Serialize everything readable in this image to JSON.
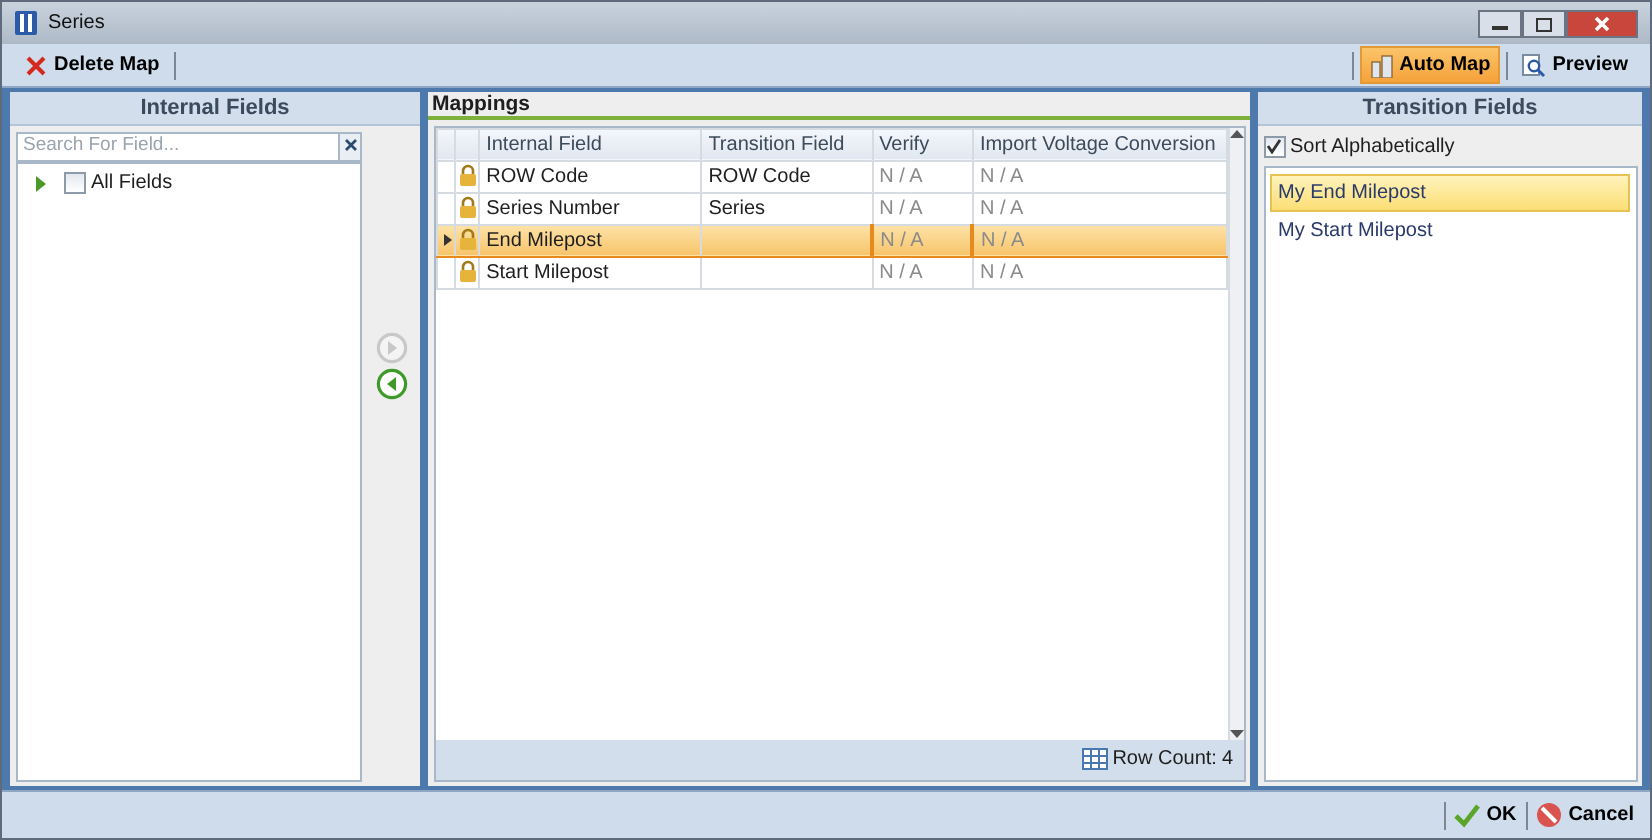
{
  "window": {
    "title": "Series"
  },
  "toolbar": {
    "left": [
      {
        "label": "Delete Map",
        "kind": "delete",
        "pressed": false
      }
    ],
    "right": [
      {
        "label": "Auto Map",
        "kind": "automap",
        "pressed": true
      },
      {
        "label": "Preview",
        "kind": "preview",
        "pressed": false
      }
    ]
  },
  "internal_fields": {
    "title": "Internal Fields",
    "search": {
      "placeholder": "Search For Field..."
    },
    "tree": [
      {
        "label": "All Fields",
        "checked": false,
        "expanded": false
      }
    ]
  },
  "move_buttons": [
    {
      "kind": "right",
      "disabled": true
    },
    {
      "kind": "left",
      "disabled": false
    }
  ],
  "mappings": {
    "title": "Mappings",
    "columns": [
      "Internal Field",
      "Transition Field",
      "Verify",
      "Import Voltage Conversion"
    ],
    "rows": [
      {
        "locked": true,
        "cells": [
          "ROW Code",
          "ROW Code",
          "N / A",
          "N / A"
        ],
        "selected": false
      },
      {
        "locked": true,
        "cells": [
          "Series Number",
          "Series",
          "N / A",
          "N / A"
        ],
        "selected": false
      },
      {
        "locked": true,
        "cells": [
          "End Milepost",
          "",
          "N / A",
          "N / A"
        ],
        "selected": true
      },
      {
        "locked": true,
        "cells": [
          "Start Milepost",
          "",
          "N / A",
          "N / A"
        ],
        "selected": false
      }
    ],
    "row_count_label": "Row Count:",
    "row_count": "4"
  },
  "transition_fields": {
    "title": "Transition Fields",
    "sort": {
      "label": "Sort Alphabetically",
      "checked": true
    },
    "items": [
      {
        "label": "My End Milepost",
        "selected": true
      },
      {
        "label": "My Start Milepost",
        "selected": false
      }
    ]
  },
  "footer": {
    "buttons": [
      {
        "label": "OK",
        "kind": "ok"
      },
      {
        "label": "Cancel",
        "kind": "cancel"
      }
    ]
  }
}
